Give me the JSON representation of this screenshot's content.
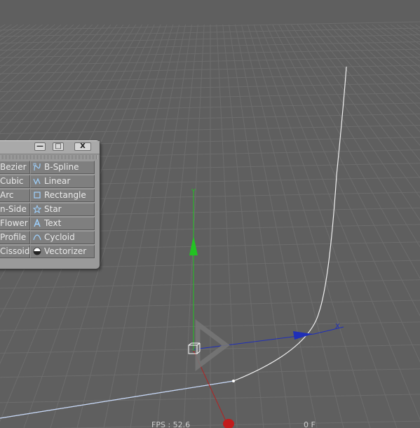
{
  "palette": {
    "window_buttons": {
      "minimize": "—",
      "maximize": "□",
      "close": "X"
    },
    "left_items": [
      {
        "label": "Bezier"
      },
      {
        "label": "Cubic"
      },
      {
        "label": "Arc"
      },
      {
        "label": "n-Side"
      },
      {
        "label": "Flower"
      },
      {
        "label": "Profile"
      },
      {
        "label": "Cissoid"
      }
    ],
    "right_items": [
      {
        "label": "B-Spline",
        "icon": "b-spline-icon"
      },
      {
        "label": "Linear",
        "icon": "linear-icon"
      },
      {
        "label": "Rectangle",
        "icon": "rectangle-icon"
      },
      {
        "label": "Star",
        "icon": "star-icon"
      },
      {
        "label": "Text",
        "icon": "text-icon"
      },
      {
        "label": "Cycloid",
        "icon": "cycloid-icon"
      },
      {
        "label": "Vectorizer",
        "icon": "vectorizer-icon"
      }
    ]
  },
  "viewport": {
    "fps_label": "FPS : 52.6",
    "frame_label": "0 F",
    "y_axis_label": "Y",
    "x_axis_label": "X",
    "colors": {
      "background": "#5f5f5f",
      "grid": "#6d6d6d",
      "spline": "#f2f2f2",
      "y_axis": "#22c322",
      "x_axis": "#1f2fb8",
      "z_axis": "#b22222"
    }
  }
}
